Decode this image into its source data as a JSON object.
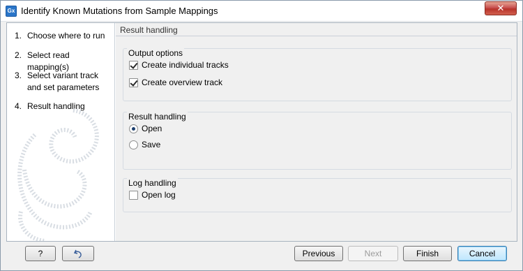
{
  "window": {
    "title": "Identify Known Mutations from Sample Mappings",
    "app_icon_text": "Gx",
    "close_glyph": "✕"
  },
  "steps": [
    {
      "num": "1.",
      "label": "Choose where to run"
    },
    {
      "num": "2.",
      "label": "Select read mapping(s)"
    },
    {
      "num": "3.",
      "label": "Select variant track and set parameters"
    },
    {
      "num": "4.",
      "label": "Result handling"
    }
  ],
  "content": {
    "title": "Result handling",
    "output_options": {
      "title": "Output options",
      "create_individual_tracks": {
        "label": "Create individual tracks",
        "checked": true
      },
      "create_overview_track": {
        "label": "Create overview track",
        "checked": true
      }
    },
    "result_handling": {
      "title": "Result handling",
      "open": {
        "label": "Open",
        "selected": true
      },
      "save": {
        "label": "Save",
        "selected": false
      }
    },
    "log_handling": {
      "title": "Log handling",
      "open_log": {
        "label": "Open log",
        "checked": false
      }
    }
  },
  "buttons": {
    "help": "?",
    "reset_icon": "reset-arrow-icon",
    "previous": "Previous",
    "next": "Next",
    "finish": "Finish",
    "cancel": "Cancel"
  }
}
